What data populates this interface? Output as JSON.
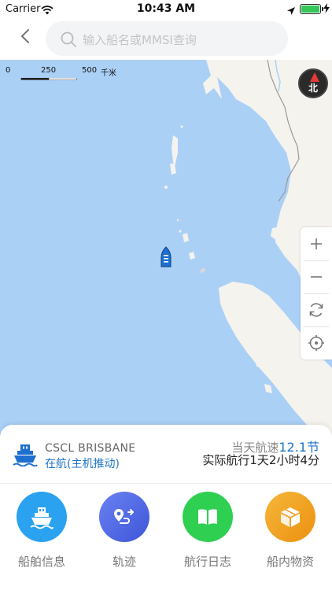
{
  "status_bar": {
    "carrier": "Carrier",
    "time": "10:43 AM",
    "battery_color": "#35c759"
  },
  "nav": {
    "back_icon": "chevron-left-icon",
    "search_placeholder": "输入船名或MMSI查询"
  },
  "map": {
    "ocean_color": "#abd0f6",
    "land_color": "#f5f3ee",
    "scale": {
      "labels": [
        "0",
        "250",
        "500"
      ],
      "unit": "千米"
    },
    "compass_label": "北",
    "controls": [
      "zoom-in",
      "zoom-out",
      "rotate",
      "locate"
    ]
  },
  "vessel": {
    "name": "CSCL BRISBANE",
    "status": "在航(主机推动)",
    "speed_label": "当天航速",
    "speed_value": "12.1节",
    "voyage_time": "实际航行1天2小时4分",
    "accent_color": "#1e73c8"
  },
  "actions": [
    {
      "label": "船舶信息",
      "icon": "ship-info-icon",
      "color": "#2aa2f0"
    },
    {
      "label": "轨迹",
      "icon": "track-icon",
      "color": "#4f6be6"
    },
    {
      "label": "航行日志",
      "icon": "logbook-icon",
      "color": "#2fcf52"
    },
    {
      "label": "船内物资",
      "icon": "supplies-icon",
      "color": "#f0a31d"
    }
  ]
}
